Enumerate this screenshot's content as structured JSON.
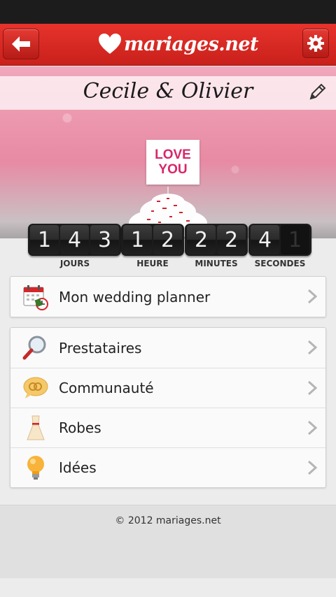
{
  "app": {
    "logo_text": "mariages.net"
  },
  "couple": {
    "name": "Cecile & Olivier"
  },
  "hero": {
    "card_line1": "LOVE",
    "card_line2": "YOU"
  },
  "countdown": [
    {
      "unit": "JOURS",
      "digits": [
        "1",
        "4",
        "3"
      ]
    },
    {
      "unit": "HEURE",
      "digits": [
        "1",
        "2"
      ]
    },
    {
      "unit": "MINUTES",
      "digits": [
        "2",
        "2"
      ]
    },
    {
      "unit": "SECONDES",
      "digits": [
        "4",
        "1"
      ]
    }
  ],
  "planner": {
    "label": "Mon wedding planner",
    "icon": "calendar-icon"
  },
  "menu": [
    {
      "label": "Prestataires",
      "icon": "magnifier-icon"
    },
    {
      "label": "Communauté",
      "icon": "chat-rings-icon"
    },
    {
      "label": "Robes",
      "icon": "dress-icon"
    },
    {
      "label": "Idées",
      "icon": "lightbulb-icon"
    }
  ],
  "footer": {
    "copyright": "© 2012 mariages.net"
  },
  "colors": {
    "header_red": "#d9261f",
    "card_bg": "#fafafa",
    "accent_pink": "#d9266a"
  }
}
